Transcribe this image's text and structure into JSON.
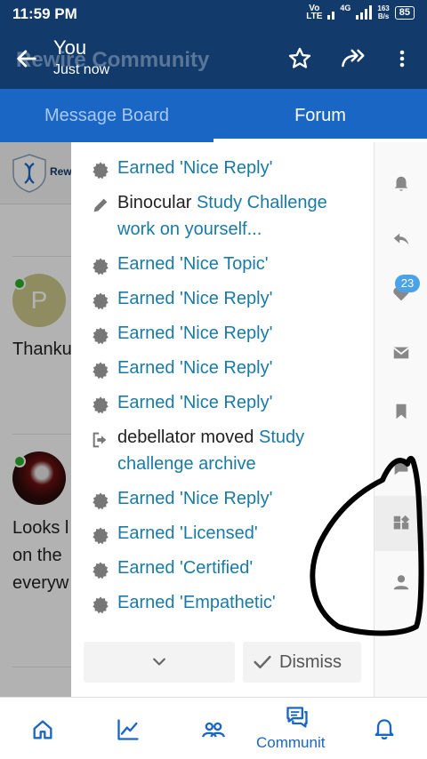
{
  "status_bar": {
    "time": "11:59 PM",
    "network_vo": "Vo",
    "network_lte": "LTE",
    "signal_label": "4G",
    "speed_value": "163",
    "speed_unit": "B/s",
    "battery": "85"
  },
  "header": {
    "background_title": "Rewire Community",
    "title": "You",
    "subtitle": "Just now"
  },
  "tabs": [
    {
      "label": "Message Board",
      "active": false
    },
    {
      "label": "Forum",
      "active": true
    }
  ],
  "background": {
    "banner_text": "Rew",
    "post1_avatar_letter": "P",
    "post1_text": "Thanku",
    "post2_lines": [
      "Looks l",
      "on the",
      "everyw"
    ]
  },
  "notifications": [
    {
      "icon": "badge-icon",
      "prefix": "",
      "link": "Earned 'Nice Reply'"
    },
    {
      "icon": "pencil-icon",
      "prefix": "Binocular ",
      "link": "Study Challenge work on yourself..."
    },
    {
      "icon": "badge-icon",
      "prefix": "",
      "link": "Earned 'Nice Topic'"
    },
    {
      "icon": "badge-icon",
      "prefix": "",
      "link": "Earned 'Nice Reply'"
    },
    {
      "icon": "badge-icon",
      "prefix": "",
      "link": "Earned 'Nice Reply'"
    },
    {
      "icon": "badge-icon",
      "prefix": "",
      "link": "Earned 'Nice Reply'"
    },
    {
      "icon": "badge-icon",
      "prefix": "",
      "link": "Earned 'Nice Reply'"
    },
    {
      "icon": "move-icon",
      "prefix": "debellator moved ",
      "link": "Study challenge archive"
    },
    {
      "icon": "badge-icon",
      "prefix": "",
      "link": "Earned 'Nice Reply'"
    },
    {
      "icon": "badge-icon",
      "prefix": "",
      "link": "Earned 'Licensed'"
    },
    {
      "icon": "badge-icon",
      "prefix": "",
      "link": "Earned 'Certified'"
    },
    {
      "icon": "badge-icon",
      "prefix": "",
      "link": "Earned 'Empathetic'"
    }
  ],
  "panel_footer": {
    "expand_icon": "chevron-down-icon",
    "dismiss_label": "Dismiss"
  },
  "rail": {
    "items": [
      "bell-icon",
      "reply-icon",
      "heart-icon",
      "mail-icon",
      "bookmark-icon",
      "chat-icon",
      "widgets-icon",
      "user-icon"
    ],
    "likes_badge": "23"
  },
  "bottom_nav": {
    "community_label": "Communit"
  },
  "colors": {
    "header": "#123a6b",
    "tabs": "#1a66c4",
    "link": "#1a7aa5",
    "badge": "#4aa3e8"
  }
}
